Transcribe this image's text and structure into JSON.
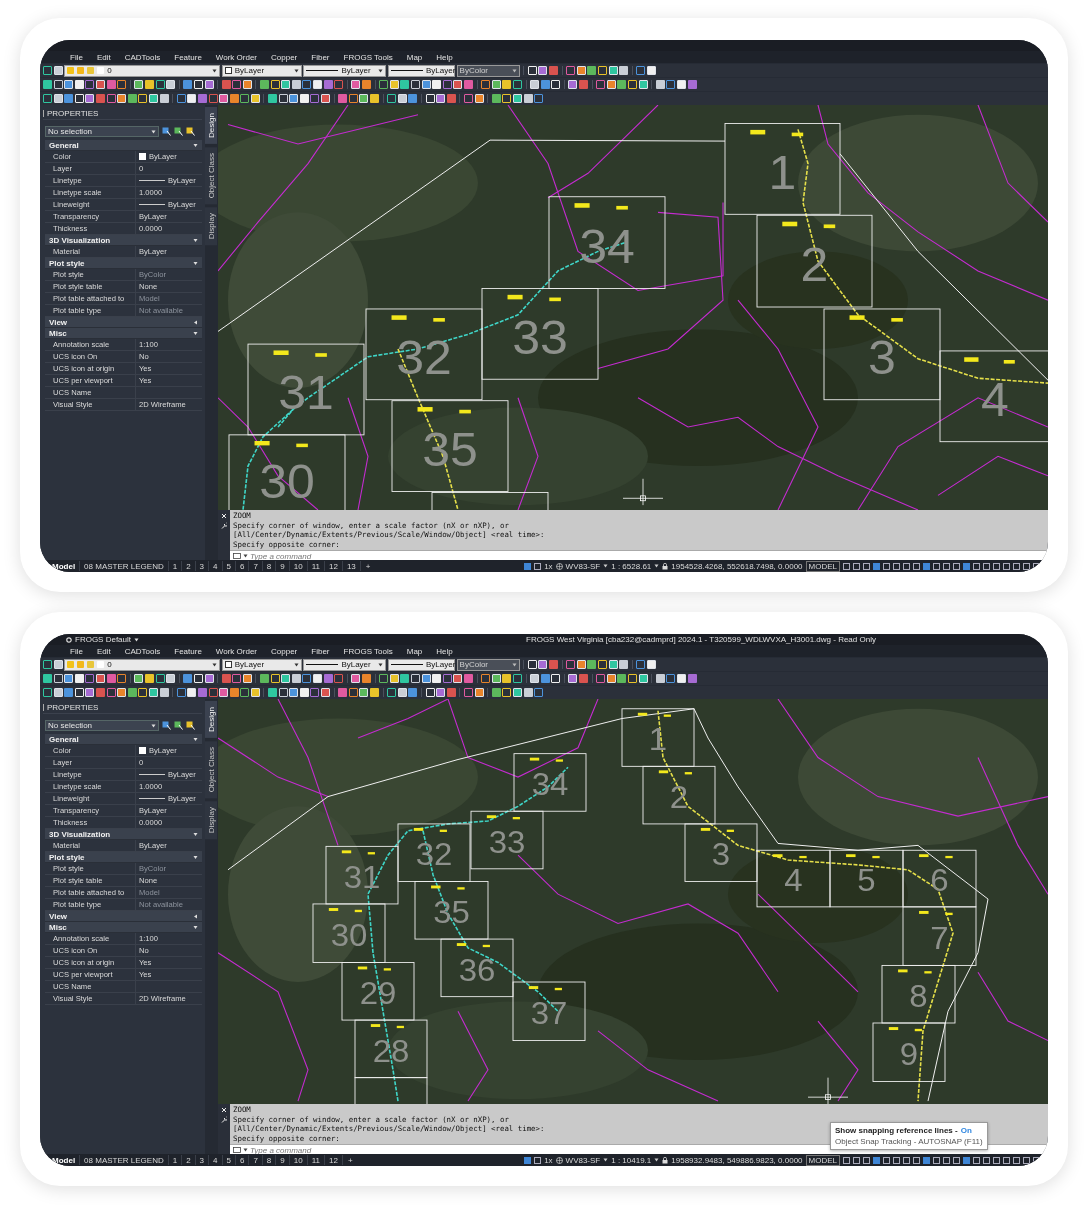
{
  "windows": [
    {
      "menu": [
        "File",
        "Edit",
        "CADTools",
        "Feature",
        "Work Order",
        "Copper",
        "Fiber",
        "FROGS Tools",
        "Map",
        "Help"
      ],
      "toolbar_dropdowns": [
        {
          "kind": "layer",
          "value": "0",
          "disabled": false
        },
        {
          "kind": "color",
          "value": "ByLayer",
          "disabled": false
        },
        {
          "kind": "linetype",
          "value": "ByLayer",
          "disabled": false
        },
        {
          "kind": "lineweight",
          "value": "ByLayer",
          "disabled": false
        },
        {
          "kind": "plotstyle",
          "value": "ByColor",
          "disabled": true
        }
      ],
      "properties": {
        "title": "PROPERTIES",
        "selection": "No selection",
        "sections": [
          {
            "name": "General",
            "expanded": true,
            "rows": [
              {
                "label": "Color",
                "value": "ByLayer",
                "kind": "swatch",
                "disabled": false
              },
              {
                "label": "Layer",
                "value": "0",
                "kind": "text",
                "disabled": false
              },
              {
                "label": "Linetype",
                "value": "ByLayer",
                "kind": "line",
                "disabled": false
              },
              {
                "label": "Linetype scale",
                "value": "1.0000",
                "kind": "text",
                "disabled": false
              },
              {
                "label": "Lineweight",
                "value": "ByLayer",
                "kind": "line",
                "disabled": false
              },
              {
                "label": "Transparency",
                "value": "ByLayer",
                "kind": "text",
                "disabled": false
              },
              {
                "label": "Thickness",
                "value": "0.0000",
                "kind": "text",
                "disabled": false
              }
            ]
          },
          {
            "name": "3D Visualization",
            "expanded": true,
            "rows": [
              {
                "label": "Material",
                "value": "ByLayer",
                "kind": "text",
                "disabled": false
              }
            ]
          },
          {
            "name": "Plot style",
            "expanded": true,
            "rows": [
              {
                "label": "Plot style",
                "value": "ByColor",
                "kind": "text",
                "disabled": true
              },
              {
                "label": "Plot style table",
                "value": "None",
                "kind": "text",
                "disabled": false
              },
              {
                "label": "Plot table attached to",
                "value": "Model",
                "kind": "text",
                "disabled": true
              },
              {
                "label": "Plot table type",
                "value": "Not available",
                "kind": "text",
                "disabled": true
              }
            ]
          },
          {
            "name": "View",
            "expanded": false
          },
          {
            "name": "Misc",
            "expanded": true,
            "rows": [
              {
                "label": "Annotation scale",
                "value": "1:100",
                "kind": "text",
                "disabled": false
              },
              {
                "label": "UCS icon On",
                "value": "No",
                "kind": "text",
                "disabled": false
              },
              {
                "label": "UCS icon at origin",
                "value": "Yes",
                "kind": "text",
                "disabled": false
              },
              {
                "label": "UCS per viewport",
                "value": "Yes",
                "kind": "text",
                "disabled": false
              },
              {
                "label": "UCS Name",
                "kind": "text",
                "disabled": false
              },
              {
                "label": "Visual Style",
                "value": "2D Wireframe",
                "kind": "text",
                "disabled": false
              }
            ]
          }
        ]
      },
      "side_tabs": [
        {
          "label": "Design",
          "selected": true
        },
        {
          "label": "Object Class",
          "selected": false
        },
        {
          "label": "Display",
          "selected": false
        }
      ],
      "sheets": [
        {
          "label": "1"
        },
        {
          "label": "2"
        },
        {
          "label": "3"
        },
        {
          "label": "4"
        },
        {
          "label": "34"
        },
        {
          "label": "33"
        },
        {
          "label": "32"
        },
        {
          "label": "31"
        },
        {
          "label": "35"
        },
        {
          "label": "30"
        }
      ],
      "command": {
        "lines": [
          "ZOOM",
          "Specify corner of window, enter a scale factor (nX or nXP), or",
          "[All/Center/Dynamic/Extents/Previous/Scale/Window/Object] <real time>:",
          "Specify opposite corner:"
        ],
        "placeholder": "Type a command"
      },
      "layout_tabs": [
        {
          "label": "Model",
          "selected": true
        },
        {
          "label": "08 MASTER LEGEND",
          "selected": false
        },
        {
          "label": "1",
          "selected": false
        },
        {
          "label": "2",
          "selected": false
        },
        {
          "label": "3",
          "selected": false
        },
        {
          "label": "4",
          "selected": false
        },
        {
          "label": "5",
          "selected": false
        },
        {
          "label": "6",
          "selected": false
        },
        {
          "label": "7",
          "selected": false
        },
        {
          "label": "8",
          "selected": false
        },
        {
          "label": "9",
          "selected": false
        },
        {
          "label": "10",
          "selected": false
        },
        {
          "label": "11",
          "selected": false
        },
        {
          "label": "12",
          "selected": false
        },
        {
          "label": "13",
          "selected": false
        }
      ],
      "add_tab": "+",
      "status": {
        "annotation_scale": "1x",
        "coordinate_system": "WV83-SF",
        "scale": "1 : 6528.61",
        "coordinates": "1954528.4268, 552618.7498, 0.0000",
        "space": "MODEL"
      }
    },
    {
      "workspace": "FROGS Default",
      "title": "FROGS West Virginia [cba232@cadmprd] 2024.1 - T320599_WDLWVXA_H3001.dwg - Read Only",
      "menu": [
        "File",
        "Edit",
        "CADTools",
        "Feature",
        "Work Order",
        "Copper",
        "Fiber",
        "FROGS Tools",
        "Map",
        "Help"
      ],
      "toolbar_dropdowns": [
        {
          "kind": "layer",
          "value": "0",
          "disabled": false
        },
        {
          "kind": "color",
          "value": "ByLayer",
          "disabled": false
        },
        {
          "kind": "linetype",
          "value": "ByLayer",
          "disabled": false
        },
        {
          "kind": "lineweight",
          "value": "ByLayer",
          "disabled": false
        },
        {
          "kind": "plotstyle",
          "value": "ByColor",
          "disabled": true
        }
      ],
      "properties": {
        "title": "PROPERTIES",
        "selection": "No selection",
        "sections": [
          {
            "name": "General",
            "expanded": true,
            "rows": [
              {
                "label": "Color",
                "value": "ByLayer",
                "kind": "swatch",
                "disabled": false
              },
              {
                "label": "Layer",
                "value": "0",
                "kind": "text",
                "disabled": false
              },
              {
                "label": "Linetype",
                "value": "ByLayer",
                "kind": "line",
                "disabled": false
              },
              {
                "label": "Linetype scale",
                "value": "1.0000",
                "kind": "text",
                "disabled": false
              },
              {
                "label": "Lineweight",
                "value": "ByLayer",
                "kind": "line",
                "disabled": false
              },
              {
                "label": "Transparency",
                "value": "ByLayer",
                "kind": "text",
                "disabled": false
              },
              {
                "label": "Thickness",
                "value": "0.0000",
                "kind": "text",
                "disabled": false
              }
            ]
          },
          {
            "name": "3D Visualization",
            "expanded": true,
            "rows": [
              {
                "label": "Material",
                "value": "ByLayer",
                "kind": "text",
                "disabled": false
              }
            ]
          },
          {
            "name": "Plot style",
            "expanded": true,
            "rows": [
              {
                "label": "Plot style",
                "value": "ByColor",
                "kind": "text",
                "disabled": true
              },
              {
                "label": "Plot style table",
                "value": "None",
                "kind": "text",
                "disabled": false
              },
              {
                "label": "Plot table attached to",
                "value": "Model",
                "kind": "text",
                "disabled": true
              },
              {
                "label": "Plot table type",
                "value": "Not available",
                "kind": "text",
                "disabled": true
              }
            ]
          },
          {
            "name": "View",
            "expanded": false
          },
          {
            "name": "Misc",
            "expanded": true,
            "rows": [
              {
                "label": "Annotation scale",
                "value": "1:100",
                "kind": "text",
                "disabled": false
              },
              {
                "label": "UCS icon On",
                "value": "No",
                "kind": "text",
                "disabled": false
              },
              {
                "label": "UCS icon at origin",
                "value": "Yes",
                "kind": "text",
                "disabled": false
              },
              {
                "label": "UCS per viewport",
                "value": "Yes",
                "kind": "text",
                "disabled": false
              },
              {
                "label": "UCS Name",
                "kind": "text",
                "disabled": false
              },
              {
                "label": "Visual Style",
                "value": "2D Wireframe",
                "kind": "text",
                "disabled": false
              }
            ]
          }
        ]
      },
      "side_tabs": [
        {
          "label": "Design",
          "selected": true
        },
        {
          "label": "Object Class",
          "selected": false
        },
        {
          "label": "Display",
          "selected": false
        }
      ],
      "sheets": [
        {
          "label": "1"
        },
        {
          "label": "2"
        },
        {
          "label": "3"
        },
        {
          "label": "4"
        },
        {
          "label": "5"
        },
        {
          "label": "6"
        },
        {
          "label": "7"
        },
        {
          "label": "8"
        },
        {
          "label": "9"
        },
        {
          "label": "34"
        },
        {
          "label": "33"
        },
        {
          "label": "32"
        },
        {
          "label": "31"
        },
        {
          "label": "30"
        },
        {
          "label": "35"
        },
        {
          "label": "36"
        },
        {
          "label": "37"
        },
        {
          "label": "29"
        },
        {
          "label": "28"
        }
      ],
      "command": {
        "lines": [
          "ZOOM",
          "Specify corner of window, enter a scale factor (nX or nXP), or",
          "[All/Center/Dynamic/Extents/Previous/Scale/Window/Object] <real time>:",
          "Specify opposite corner:"
        ],
        "placeholder": "Type a command"
      },
      "layout_tabs": [
        {
          "label": "Model",
          "selected": true
        },
        {
          "label": "08 MASTER LEGEND",
          "selected": false
        },
        {
          "label": "1",
          "selected": false
        },
        {
          "label": "2",
          "selected": false
        },
        {
          "label": "3",
          "selected": false
        },
        {
          "label": "4",
          "selected": false
        },
        {
          "label": "5",
          "selected": false
        },
        {
          "label": "6",
          "selected": false
        },
        {
          "label": "7",
          "selected": false
        },
        {
          "label": "8",
          "selected": false
        },
        {
          "label": "9",
          "selected": false
        },
        {
          "label": "10",
          "selected": false
        },
        {
          "label": "11",
          "selected": false
        },
        {
          "label": "12",
          "selected": false
        }
      ],
      "add_tab": "+",
      "status": {
        "annotation_scale": "1x",
        "coordinate_system": "WV83-SF",
        "scale": "1 : 10419.1",
        "coordinates": "1958932.9483, 549886.9823, 0.0000",
        "space": "MODEL"
      },
      "tooltip": {
        "title": "Show snapping reference lines -",
        "state": "On",
        "detail": "Object Snap Tracking - AUTOSNAP (F11)"
      }
    }
  ]
}
